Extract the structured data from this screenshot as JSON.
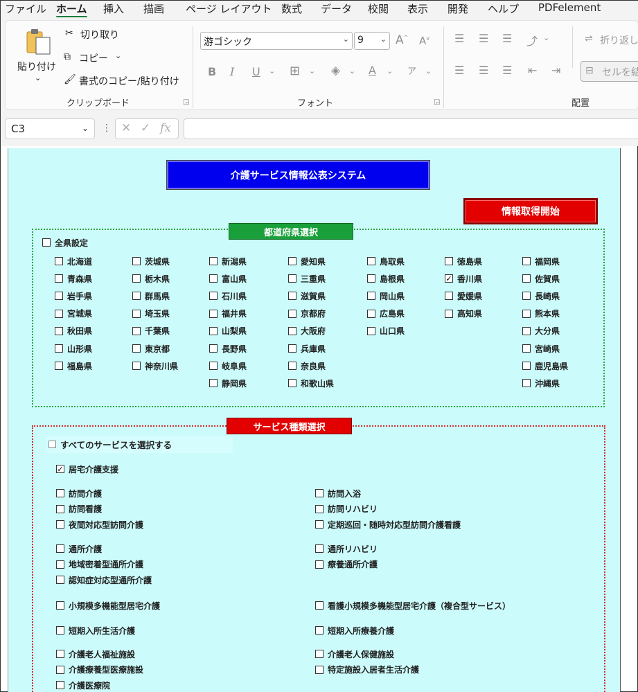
{
  "menu": [
    "ファイル",
    "ホーム",
    "挿入",
    "描画",
    "ページ レイアウト",
    "数式",
    "データ",
    "校閲",
    "表示",
    "開発",
    "ヘルプ",
    "PDFelement"
  ],
  "ribbon": {
    "paste": "貼り付け",
    "cut": "切り取り",
    "copy": "コピー",
    "format_painter": "書式のコピー/貼り付け",
    "clipboard_group": "クリップボード",
    "font_name": "游ゴシック",
    "font_size": "9",
    "font_group": "フォント",
    "align_group": "配置",
    "wrap_text": "折り返し",
    "merge": "セルを結"
  },
  "formula_bar": {
    "name_box": "C3",
    "fx": "fx"
  },
  "sheet": {
    "title": "介護サービス情報公表システム",
    "start_button": "情報取得開始",
    "pref_label": "都道府県選択",
    "all_prefectures": "全県設定",
    "pref_columns": [
      [
        {
          "n": "北海道",
          "c": false
        },
        {
          "n": "青森県",
          "c": false
        },
        {
          "n": "岩手県",
          "c": false
        },
        {
          "n": "宮城県",
          "c": false
        },
        {
          "n": "秋田県",
          "c": false
        },
        {
          "n": "山形県",
          "c": false
        },
        {
          "n": "福島県",
          "c": false
        }
      ],
      [
        {
          "n": "茨城県",
          "c": false
        },
        {
          "n": "栃木県",
          "c": false
        },
        {
          "n": "群馬県",
          "c": false
        },
        {
          "n": "埼玉県",
          "c": false
        },
        {
          "n": "千葉県",
          "c": false
        },
        {
          "n": "東京都",
          "c": false
        },
        {
          "n": "神奈川県",
          "c": false
        }
      ],
      [
        {
          "n": "新潟県",
          "c": false
        },
        {
          "n": "富山県",
          "c": false
        },
        {
          "n": "石川県",
          "c": false
        },
        {
          "n": "福井県",
          "c": false
        },
        {
          "n": "山梨県",
          "c": false
        },
        {
          "n": "長野県",
          "c": false
        },
        {
          "n": "岐阜県",
          "c": false
        },
        {
          "n": "静岡県",
          "c": false
        }
      ],
      [
        {
          "n": "愛知県",
          "c": false
        },
        {
          "n": "三重県",
          "c": false
        },
        {
          "n": "滋賀県",
          "c": false
        },
        {
          "n": "京都府",
          "c": false
        },
        {
          "n": "大阪府",
          "c": false
        },
        {
          "n": "兵庫県",
          "c": false
        },
        {
          "n": "奈良県",
          "c": false
        },
        {
          "n": "和歌山県",
          "c": false
        }
      ],
      [
        {
          "n": "鳥取県",
          "c": false
        },
        {
          "n": "島根県",
          "c": false
        },
        {
          "n": "岡山県",
          "c": false
        },
        {
          "n": "広島県",
          "c": false
        },
        {
          "n": "山口県",
          "c": false
        }
      ],
      [
        {
          "n": "徳島県",
          "c": false
        },
        {
          "n": "香川県",
          "c": true
        },
        {
          "n": "愛媛県",
          "c": false
        },
        {
          "n": "高知県",
          "c": false
        }
      ],
      [
        {
          "n": "福岡県",
          "c": false
        },
        {
          "n": "佐賀県",
          "c": false
        },
        {
          "n": "長崎県",
          "c": false
        },
        {
          "n": "熊本県",
          "c": false
        },
        {
          "n": "大分県",
          "c": false
        },
        {
          "n": "宮崎県",
          "c": false
        },
        {
          "n": "鹿児島県",
          "c": false
        },
        {
          "n": "沖縄県",
          "c": false
        }
      ]
    ],
    "service_label": "サービス種類選択",
    "select_all_services": "すべてのサービスを選択する",
    "home_care_support": "居宅介護支援",
    "home_care_support_checked": true,
    "services_left": [
      [
        {
          "n": "訪問介護",
          "c": false
        },
        {
          "n": "訪問看護",
          "c": false
        },
        {
          "n": "夜間対応型訪問介護",
          "c": false
        }
      ],
      [
        {
          "n": "通所介護",
          "c": false
        },
        {
          "n": "地域密着型通所介護",
          "c": false
        },
        {
          "n": "認知症対応型通所介護",
          "c": false
        }
      ],
      [
        {
          "n": "小規模多機能型居宅介護",
          "c": false
        }
      ],
      [
        {
          "n": "短期入所生活介護",
          "c": false
        }
      ],
      [
        {
          "n": "介護老人福祉施設",
          "c": false
        },
        {
          "n": "介護療養型医療施設",
          "c": false
        },
        {
          "n": "介護医療院",
          "c": false
        }
      ]
    ],
    "services_right": [
      [
        {
          "n": "訪問入浴",
          "c": false
        },
        {
          "n": "訪問リハビリ",
          "c": false
        },
        {
          "n": "定期巡回・随時対応型訪問介護看護",
          "c": false
        }
      ],
      [
        {
          "n": "通所リハビリ",
          "c": false
        },
        {
          "n": "療養通所介護",
          "c": false
        }
      ],
      [
        {
          "n": "看護小規模多機能型居宅介護（複合型サービス）",
          "c": false
        }
      ],
      [
        {
          "n": "短期入所療養介護",
          "c": false
        }
      ],
      [
        {
          "n": "介護老人保健施設",
          "c": false
        },
        {
          "n": "特定施設入居者生活介護",
          "c": false
        }
      ]
    ]
  }
}
